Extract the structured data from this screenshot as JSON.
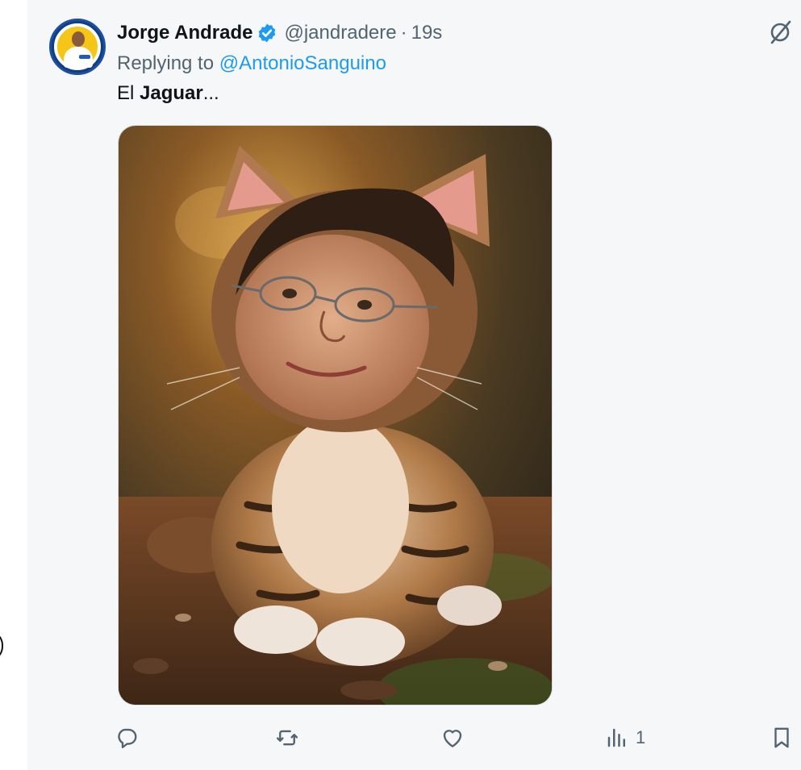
{
  "tweet": {
    "author_name": "Jorge Andrade",
    "handle": "@jandradere",
    "separator": "·",
    "time": "19s",
    "replying_prefix": "Replying to ",
    "replying_to": "@AntonioSanguino",
    "text_prefix": "El ",
    "text_bold": "Jaguar",
    "text_suffix": "...",
    "verified": true
  },
  "media": {
    "subject": "kitten with human face wearing glasses",
    "icon": "photo"
  },
  "actions": {
    "reply_icon": "reply-icon",
    "retweet_icon": "retweet-icon",
    "like_icon": "heart-icon",
    "views_icon": "views-icon",
    "views_count": "1",
    "bookmark_icon": "bookmark-icon"
  },
  "colors": {
    "link": "#1d9bf0",
    "verified": "#1d9bf0",
    "secondary_text": "#536471",
    "primary_text": "#0f1419",
    "background": "#f6f7f8"
  }
}
